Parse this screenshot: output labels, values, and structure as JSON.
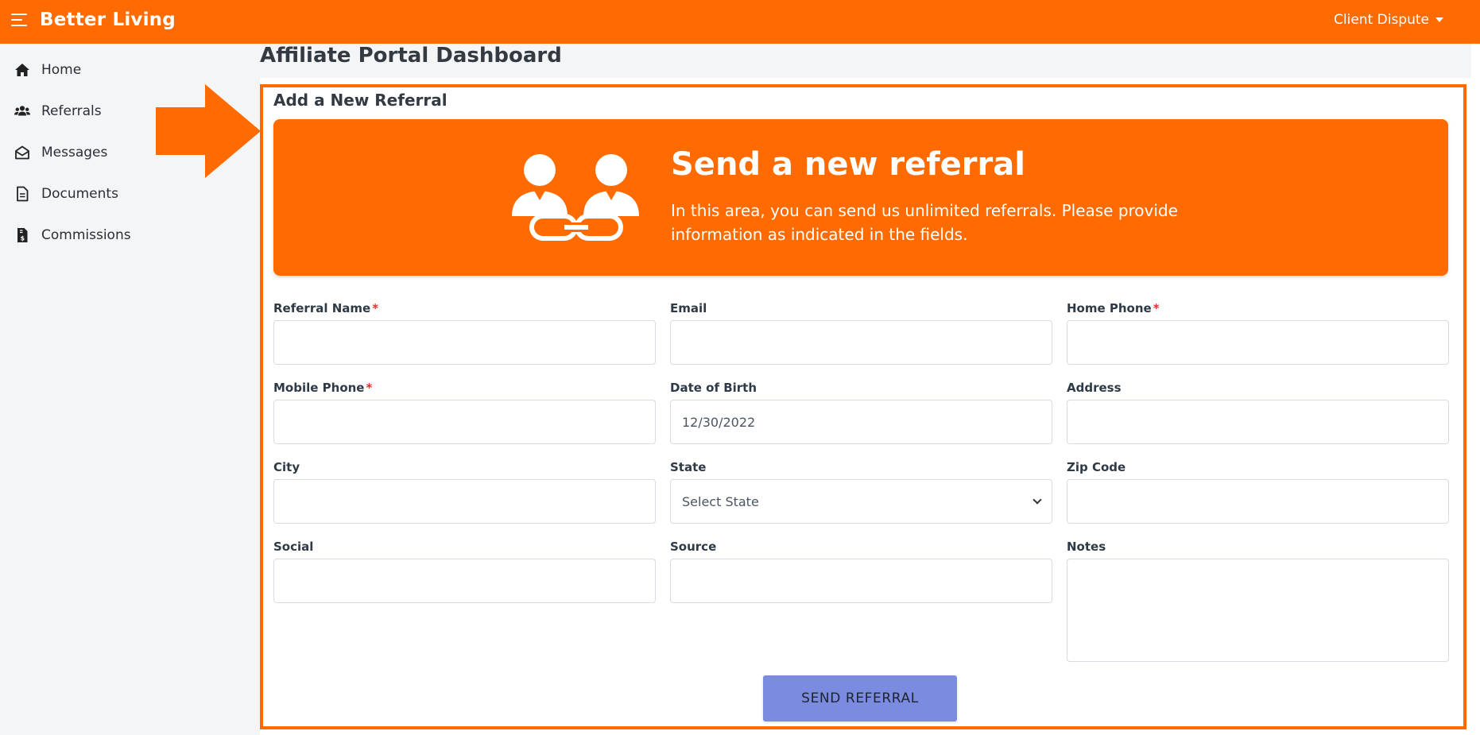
{
  "brand": "Better Living",
  "user_menu": "Client Dispute",
  "sidebar": {
    "items": [
      {
        "label": "Home",
        "icon": "home-icon"
      },
      {
        "label": "Referrals",
        "icon": "users-icon"
      },
      {
        "label": "Messages",
        "icon": "envelope-open-icon"
      },
      {
        "label": "Documents",
        "icon": "document-icon"
      },
      {
        "label": "Commissions",
        "icon": "invoice-dollar-icon"
      }
    ]
  },
  "page_title": "Affiliate Portal Dashboard",
  "card": {
    "title": "Add a New Referral",
    "hero_title": "Send a new referral",
    "hero_text": "In this area, you can send us unlimited referrals. Please provide information as indicated in the fields."
  },
  "form": {
    "referral_name": {
      "label": "Referral Name",
      "required": true,
      "value": ""
    },
    "email": {
      "label": "Email",
      "value": ""
    },
    "home_phone": {
      "label": "Home Phone",
      "required": true,
      "value": ""
    },
    "mobile_phone": {
      "label": "Mobile Phone",
      "required": true,
      "value": ""
    },
    "dob": {
      "label": "Date of Birth",
      "value": "12/30/2022"
    },
    "address": {
      "label": "Address",
      "value": ""
    },
    "city": {
      "label": "City",
      "value": ""
    },
    "state": {
      "label": "State",
      "selected": "Select State"
    },
    "zip": {
      "label": "Zip Code",
      "value": ""
    },
    "social": {
      "label": "Social",
      "value": ""
    },
    "source": {
      "label": "Source",
      "value": ""
    },
    "notes": {
      "label": "Notes",
      "value": ""
    },
    "required_mark": "*",
    "submit_label": "SEND REFERRAL"
  },
  "colors": {
    "accent": "#ff6b00",
    "button": "#7a8be0",
    "required": "#e03131"
  }
}
